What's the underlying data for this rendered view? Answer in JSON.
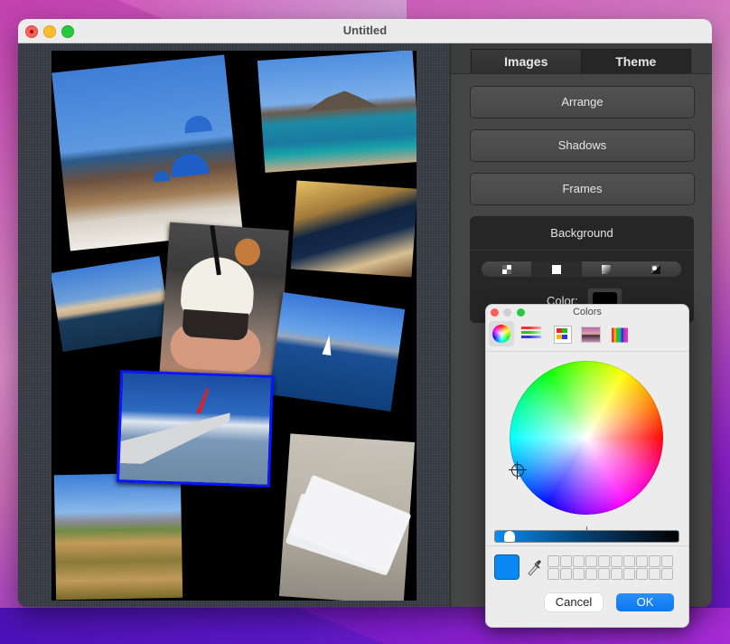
{
  "window": {
    "title": "Untitled"
  },
  "canvas": {
    "photos": [
      {
        "name": "santorini-blue-domes"
      },
      {
        "name": "balos-lagoon"
      },
      {
        "name": "santorini-night"
      },
      {
        "name": "agios-nikolaos-lake"
      },
      {
        "name": "ice-cream-cup"
      },
      {
        "name": "sailboat-sea"
      },
      {
        "name": "airplane-wing",
        "selected": true,
        "frame_color": "#0a16ff"
      },
      {
        "name": "olive-fields"
      },
      {
        "name": "boarding-passes"
      }
    ],
    "page_background": "#000000"
  },
  "sidebar": {
    "tabs": [
      {
        "label": "Images",
        "active": false
      },
      {
        "label": "Theme",
        "active": true
      }
    ],
    "buttons": {
      "arrange": "Arrange",
      "shadows": "Shadows",
      "frames": "Frames"
    },
    "background": {
      "title": "Background",
      "segments": [
        {
          "icon": "checker-icon",
          "active": false
        },
        {
          "icon": "solid-color-icon",
          "active": true
        },
        {
          "icon": "gradient-icon",
          "active": false
        },
        {
          "icon": "image-icon",
          "active": false
        }
      ],
      "color_label": "Color:",
      "color_value": "#000000"
    }
  },
  "colors_panel": {
    "title": "Colors",
    "modes": [
      {
        "icon": "color-wheel-icon",
        "active": true
      },
      {
        "icon": "color-sliders-icon",
        "active": false
      },
      {
        "icon": "color-palettes-icon",
        "active": false
      },
      {
        "icon": "image-palettes-icon",
        "active": false
      },
      {
        "icon": "pencils-icon",
        "active": false
      }
    ],
    "current_color": "#0a88f2",
    "brightness_percent": 95,
    "swatch_count": 20,
    "cancel_label": "Cancel",
    "ok_label": "OK"
  }
}
